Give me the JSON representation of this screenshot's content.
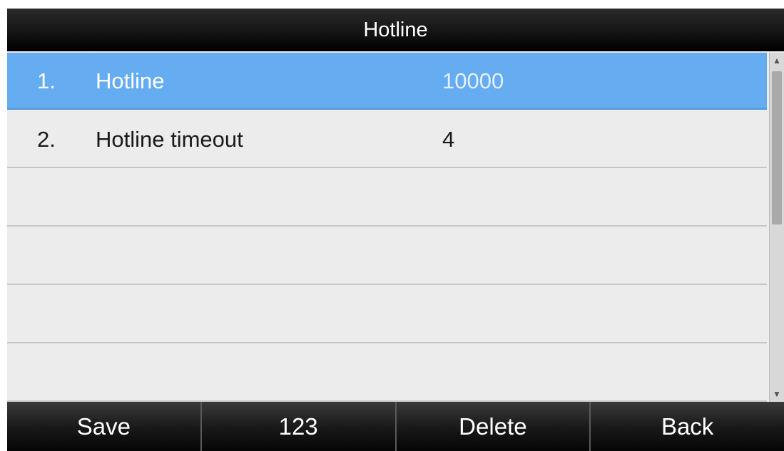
{
  "title": "Hotline",
  "rows": [
    {
      "index": "1.",
      "label": "Hotline",
      "value": "10000",
      "selected": true
    },
    {
      "index": "2.",
      "label": "Hotline timeout",
      "value": "4",
      "selected": false
    },
    {
      "index": "",
      "label": "",
      "value": "",
      "selected": false
    },
    {
      "index": "",
      "label": "",
      "value": "",
      "selected": false
    },
    {
      "index": "",
      "label": "",
      "value": "",
      "selected": false
    },
    {
      "index": "",
      "label": "",
      "value": "",
      "selected": false
    }
  ],
  "softkeys": {
    "save": "Save",
    "numeric": "123",
    "delete": "Delete",
    "back": "Back"
  },
  "icons": {
    "scroll_up": "scroll-up-arrow-icon",
    "scroll_down": "scroll-down-arrow-icon"
  },
  "colors": {
    "selection": "#66acf1",
    "title_bar": "#141414",
    "list_background": "#ececec"
  }
}
